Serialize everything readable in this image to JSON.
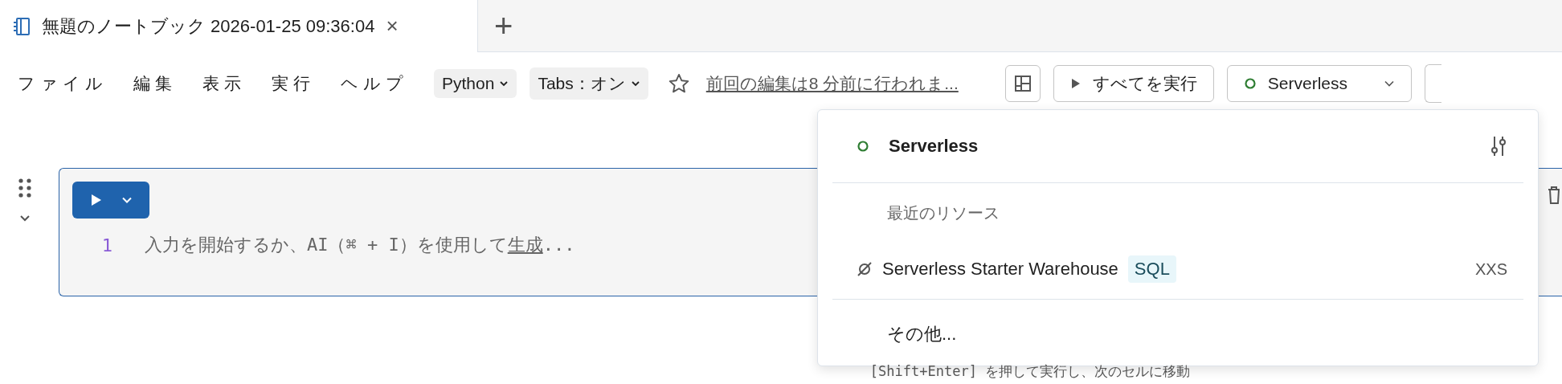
{
  "tab": {
    "title": "無題のノートブック 2026-01-25 09:36:04",
    "close": "×",
    "new_tab": "+"
  },
  "menu": [
    "ファイル",
    "編集",
    "表示",
    "実行",
    "ヘルプ"
  ],
  "toolbar": {
    "language": "Python",
    "tabs_setting": "Tabs：オン",
    "last_edit": "前回の編集は8 分前に行われま...",
    "run_all": "すべてを実行",
    "compute": "Serverless"
  },
  "cell": {
    "line_number": "1",
    "placeholder": "入力を開始するか、AI（⌘ + I）を使用して",
    "link": "生成",
    "after": "..."
  },
  "hint": "[Shift+Enter] を押して実行し、次のセルに移動",
  "dropdown": {
    "current": "Serverless",
    "section": "最近のリソース",
    "resources": [
      {
        "name": "Serverless Starter Warehouse",
        "tag": "SQL",
        "size": "XXS"
      }
    ],
    "more": "その他..."
  }
}
